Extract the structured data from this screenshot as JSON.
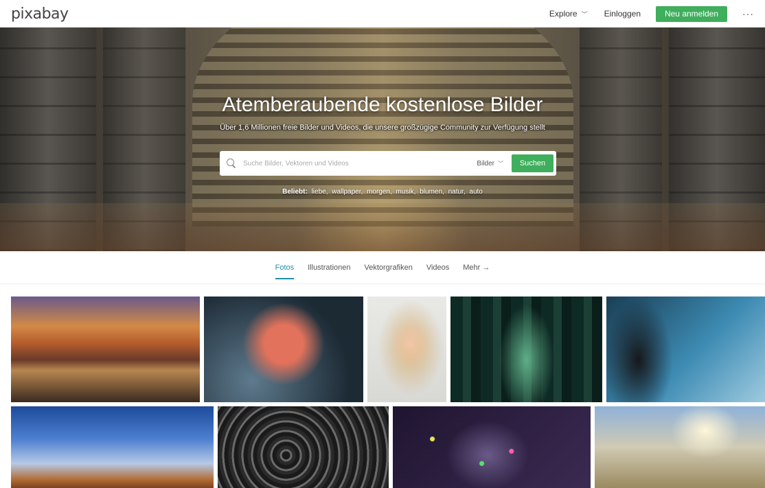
{
  "header": {
    "logo": "pixabay",
    "explore_label": "Explore",
    "login_label": "Einloggen",
    "signup_label": "Neu anmelden",
    "more_label": "···"
  },
  "hero": {
    "title": "Atemberaubende kostenlose Bilder",
    "subtitle": "Über 1,6 Millionen freie Bilder und Videos, die unsere großzügige Community zur Verfügung stellt",
    "search": {
      "placeholder": "Suche Bilder, Vektoren und Videos",
      "value": "",
      "type_selected": "Bilder",
      "button_label": "Suchen"
    },
    "popular": {
      "label": "Beliebt:",
      "tags": [
        "liebe,",
        "wallpaper,",
        "morgen,",
        "musik,",
        "blumen,",
        "natur,",
        "auto"
      ]
    }
  },
  "tabs": [
    {
      "label": "Fotos",
      "active": true
    },
    {
      "label": "Illustrationen",
      "active": false
    },
    {
      "label": "Vektorgrafiken",
      "active": false
    },
    {
      "label": "Videos",
      "active": false
    },
    {
      "label": "Mehr →",
      "active": false
    }
  ],
  "colors": {
    "accent_green": "#3fae5d",
    "active_tab": "#1e8fa8"
  }
}
